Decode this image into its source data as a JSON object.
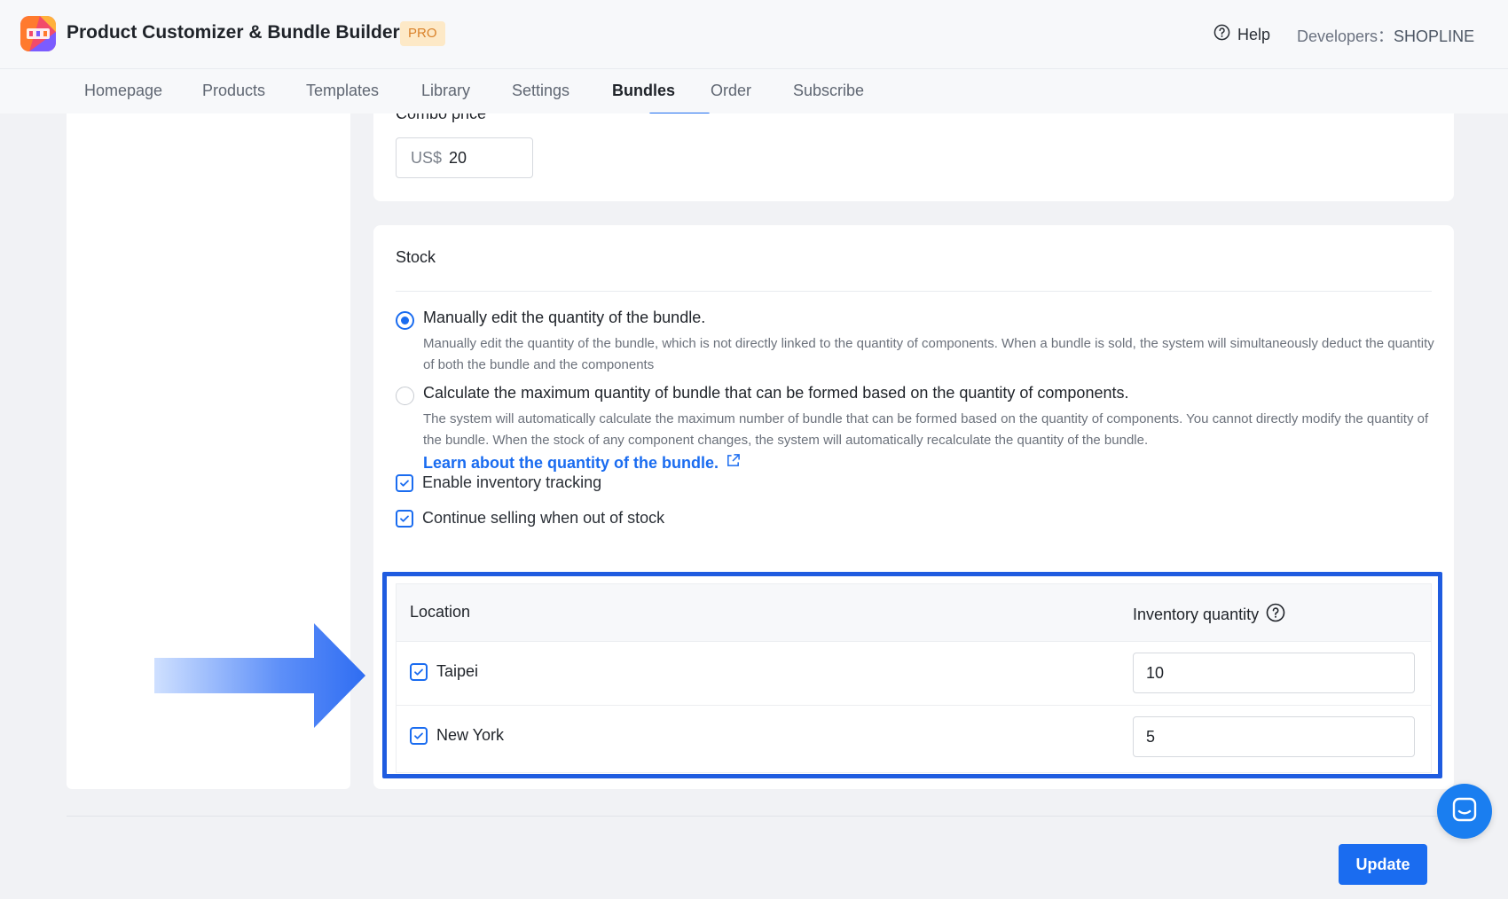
{
  "header": {
    "app_title": "Product Customizer & Bundle Builder",
    "badge": "PRO",
    "help_label": "Help",
    "developers_prefix": "Developers：",
    "developers_name": "SHOPLINE"
  },
  "nav": {
    "tabs": [
      {
        "label": "Homepage"
      },
      {
        "label": "Products"
      },
      {
        "label": "Templates"
      },
      {
        "label": "Library"
      },
      {
        "label": "Settings"
      },
      {
        "label": "Bundles",
        "active": true
      },
      {
        "label": "Order"
      },
      {
        "label": "Subscribe"
      }
    ]
  },
  "price": {
    "label": "Combo price",
    "currency": "US$",
    "value": "20"
  },
  "stock": {
    "title": "Stock",
    "option_manual": {
      "title": "Manually edit the quantity of the bundle.",
      "desc": "Manually edit the quantity of the bundle, which is not directly linked to the quantity of components. When a bundle is sold, the system will simultaneously deduct the quantity of both the bundle and the components",
      "checked": true
    },
    "option_auto": {
      "title": "Calculate the maximum quantity of bundle that can be formed based on the quantity of components.",
      "desc": "The system will automatically calculate the maximum number of bundle that can be formed based on the quantity of components. You cannot directly modify the quantity of the bundle. When the stock of any component changes, the system will automatically recalculate the quantity of the bundle.",
      "checked": false
    },
    "learn_link": "Learn about the quantity of the bundle.",
    "enable_tracking": "Enable inventory tracking",
    "continue_selling": "Continue selling when out of stock",
    "table": {
      "col_location": "Location",
      "col_quantity": "Inventory quantity",
      "rows": [
        {
          "name": "Taipei",
          "qty": "10"
        },
        {
          "name": "New York",
          "qty": "5"
        }
      ]
    }
  },
  "actions": {
    "update_label": "Update"
  },
  "colors": {
    "accent": "#1a6cf0",
    "badge_bg": "#fde9c7",
    "badge_text": "#d9822b",
    "highlight": "#1f5ce0"
  }
}
